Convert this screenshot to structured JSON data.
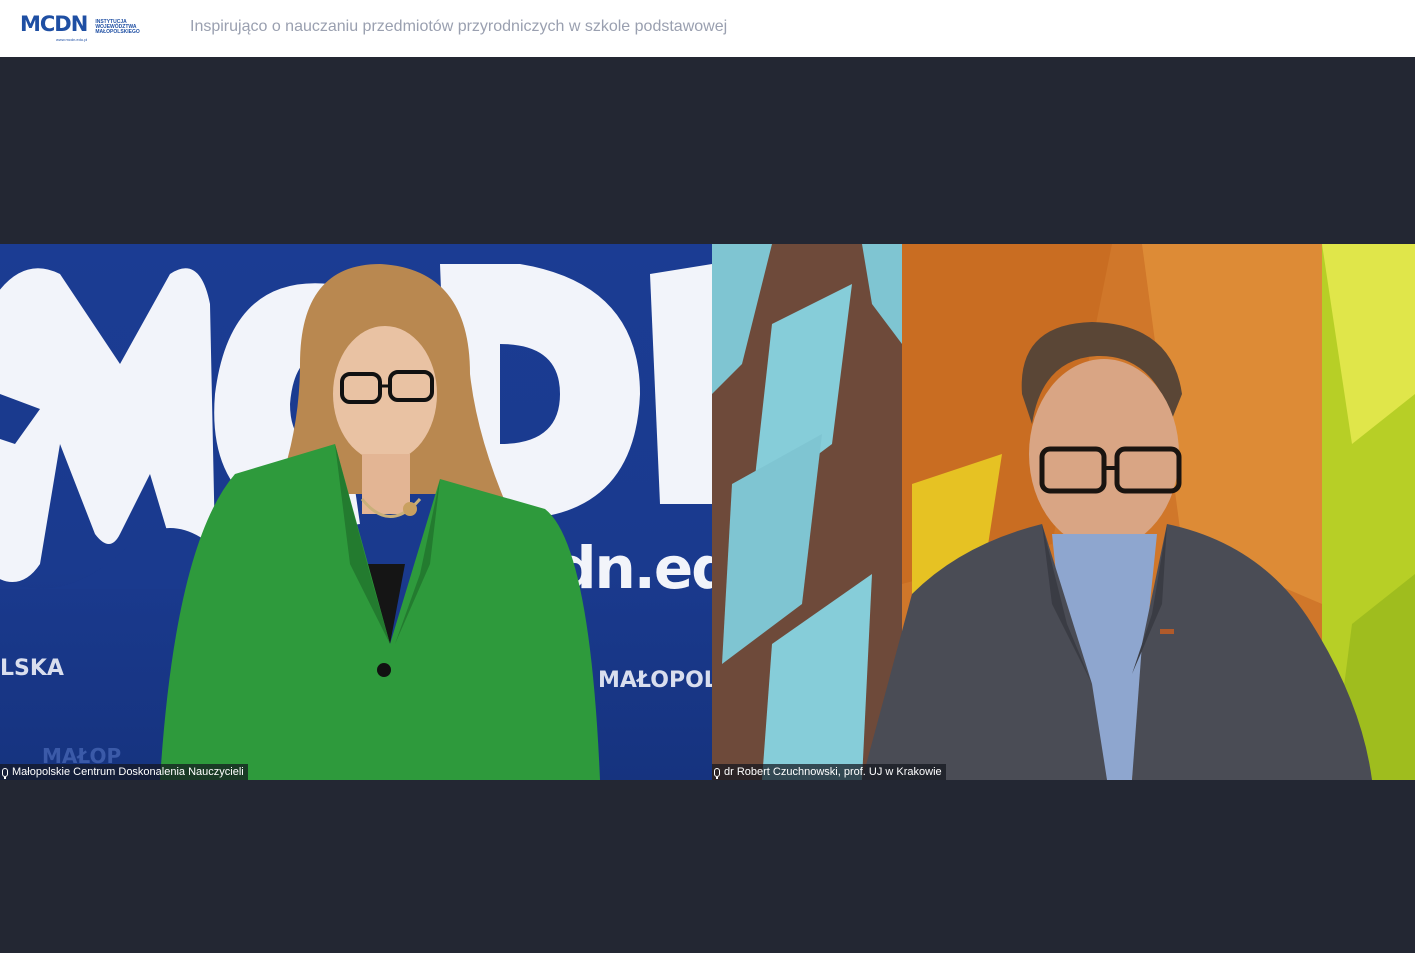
{
  "header": {
    "logo_text": "MCDN",
    "logo_url": "www.mcdn.edu.pl",
    "logo_institution": "INSTYTUCJA\nWOJEWÓDZTWA\nMAŁOPOLSKIEGO",
    "meeting_title": "Inspirująco o nauczaniu przedmiotów przyrodniczych w szkole podstawowej"
  },
  "participants": [
    {
      "name": "Małopolskie Centrum Doskonalenia Nauczycieli",
      "icon": "mic-icon",
      "background_words": [
        "MCDN",
        "dn.ed",
        "LSKA",
        "MAŁOPOL",
        "MAŁOP"
      ]
    },
    {
      "name": "dr Robert Czuchnowski, prof. UJ w Krakowie",
      "icon": "mic-icon"
    }
  ],
  "colors": {
    "header_bg": "#ffffff",
    "stage_bg": "#232733",
    "brand": "#1f4fa3",
    "title_text": "#9aa0b0"
  }
}
